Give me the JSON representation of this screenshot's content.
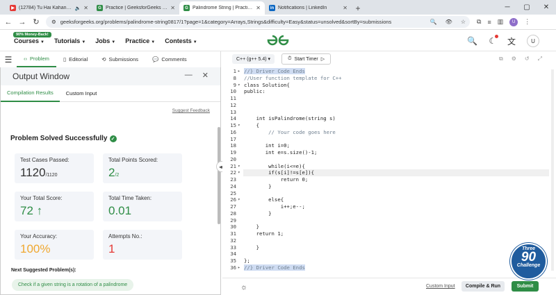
{
  "browser": {
    "tabs": [
      {
        "title": "(12784) Tu Hai Kahan (feat.",
        "fav_color": "#e53935",
        "fav_glyph": "▶"
      },
      {
        "title": "Practice | GeeksforGeeks | A co",
        "fav_color": "#2f8d46",
        "fav_glyph": "G"
      },
      {
        "title": "Palindrome String | Practice | Ge",
        "fav_color": "#2f8d46",
        "fav_glyph": "G"
      },
      {
        "title": "Notifications | LinkedIn",
        "fav_color": "#0a66c2",
        "fav_glyph": "in"
      }
    ],
    "url": "geeksforgeeks.org/problems/palindrome-string0817/1?page=1&category=Arrays,Strings&difficulty=Easy&status=unsolved&sortBy=submissions",
    "profile": "U"
  },
  "nav": {
    "badge": "90% Money-Back!",
    "menus": [
      "Courses",
      "Tutorials",
      "Jobs",
      "Practice",
      "Contests"
    ],
    "logo": "GG",
    "user": "U"
  },
  "left": {
    "tabs": [
      "Problem",
      "Editorial",
      "Submissions",
      "Comments"
    ]
  },
  "output": {
    "title": "Output Window",
    "tabs": [
      "Compilation Results",
      "Custom Input"
    ],
    "suggest_feedback": "Suggest Feedback",
    "status": "Problem Solved Successfully",
    "cards": {
      "tests_label": "Test Cases Passed:",
      "tests_value": "1120",
      "tests_total": "/1120",
      "points_label": "Total Points Scored:",
      "points_value": "2",
      "points_total": "/2",
      "score_label": "Your Total Score:",
      "score_value": "72",
      "time_label": "Total Time Taken:",
      "time_value": "0.01",
      "accuracy_label": "Your Accuracy:",
      "accuracy_value": "100%",
      "attempts_label": "Attempts No.:",
      "attempts_value": "1"
    },
    "next_title": "Next Suggested Problem(s):",
    "suggestions": [
      "Check if a given string is a rotation of a palindrome"
    ]
  },
  "editor": {
    "language": "C++ (g++ 5.4)",
    "timer": "Start Timer",
    "custom_input": "Custom Input",
    "compile_run": "Compile & Run",
    "submit": "Submit"
  },
  "promo": {
    "line1": "Three",
    "line2": "90",
    "line3": "Challenge"
  },
  "code": [
    {
      "n": "1",
      "f": "▸",
      "t": "//} Driver Code Ends",
      "c": "hl cm"
    },
    {
      "n": "8",
      "f": "",
      "t": "//User function template for C++",
      "c": "cm"
    },
    {
      "n": "9",
      "f": "▾",
      "t": "class Solution{",
      "c": ""
    },
    {
      "n": "10",
      "f": "",
      "t": "public:",
      "c": ""
    },
    {
      "n": "11",
      "f": "",
      "t": "",
      "c": ""
    },
    {
      "n": "12",
      "f": "",
      "t": "",
      "c": ""
    },
    {
      "n": "13",
      "f": "",
      "t": "",
      "c": ""
    },
    {
      "n": "14",
      "f": "",
      "t": "    int isPalindrome(string s)",
      "c": ""
    },
    {
      "n": "15",
      "f": "▾",
      "t": "    {",
      "c": ""
    },
    {
      "n": "16",
      "f": "",
      "t": "        // Your code goes here",
      "c": "cm"
    },
    {
      "n": "17",
      "f": "",
      "t": "",
      "c": ""
    },
    {
      "n": "18",
      "f": "",
      "t": "       int i=0;",
      "c": ""
    },
    {
      "n": "19",
      "f": "",
      "t": "       int e=s.size()-1;",
      "c": ""
    },
    {
      "n": "20",
      "f": "",
      "t": "",
      "c": ""
    },
    {
      "n": "21",
      "f": "▾",
      "t": "        while(i<=e){",
      "c": ""
    },
    {
      "n": "22",
      "f": "▾",
      "t": "        if(s[i]!=s[e]){",
      "c": "cur"
    },
    {
      "n": "23",
      "f": "",
      "t": "            return 0;",
      "c": ""
    },
    {
      "n": "24",
      "f": "",
      "t": "        }",
      "c": ""
    },
    {
      "n": "25",
      "f": "",
      "t": "",
      "c": ""
    },
    {
      "n": "26",
      "f": "▾",
      "t": "        else{",
      "c": ""
    },
    {
      "n": "27",
      "f": "",
      "t": "            i++;e--;",
      "c": ""
    },
    {
      "n": "28",
      "f": "",
      "t": "        }",
      "c": ""
    },
    {
      "n": "29",
      "f": "",
      "t": "",
      "c": ""
    },
    {
      "n": "30",
      "f": "",
      "t": "    }",
      "c": ""
    },
    {
      "n": "31",
      "f": "",
      "t": "    return 1;",
      "c": ""
    },
    {
      "n": "32",
      "f": "",
      "t": "",
      "c": ""
    },
    {
      "n": "33",
      "f": "",
      "t": "    }",
      "c": ""
    },
    {
      "n": "34",
      "f": "",
      "t": "",
      "c": ""
    },
    {
      "n": "35",
      "f": "",
      "t": "};",
      "c": ""
    },
    {
      "n": "36",
      "f": "▸",
      "t": "//} Driver Code Ends",
      "c": "hl cm"
    }
  ]
}
